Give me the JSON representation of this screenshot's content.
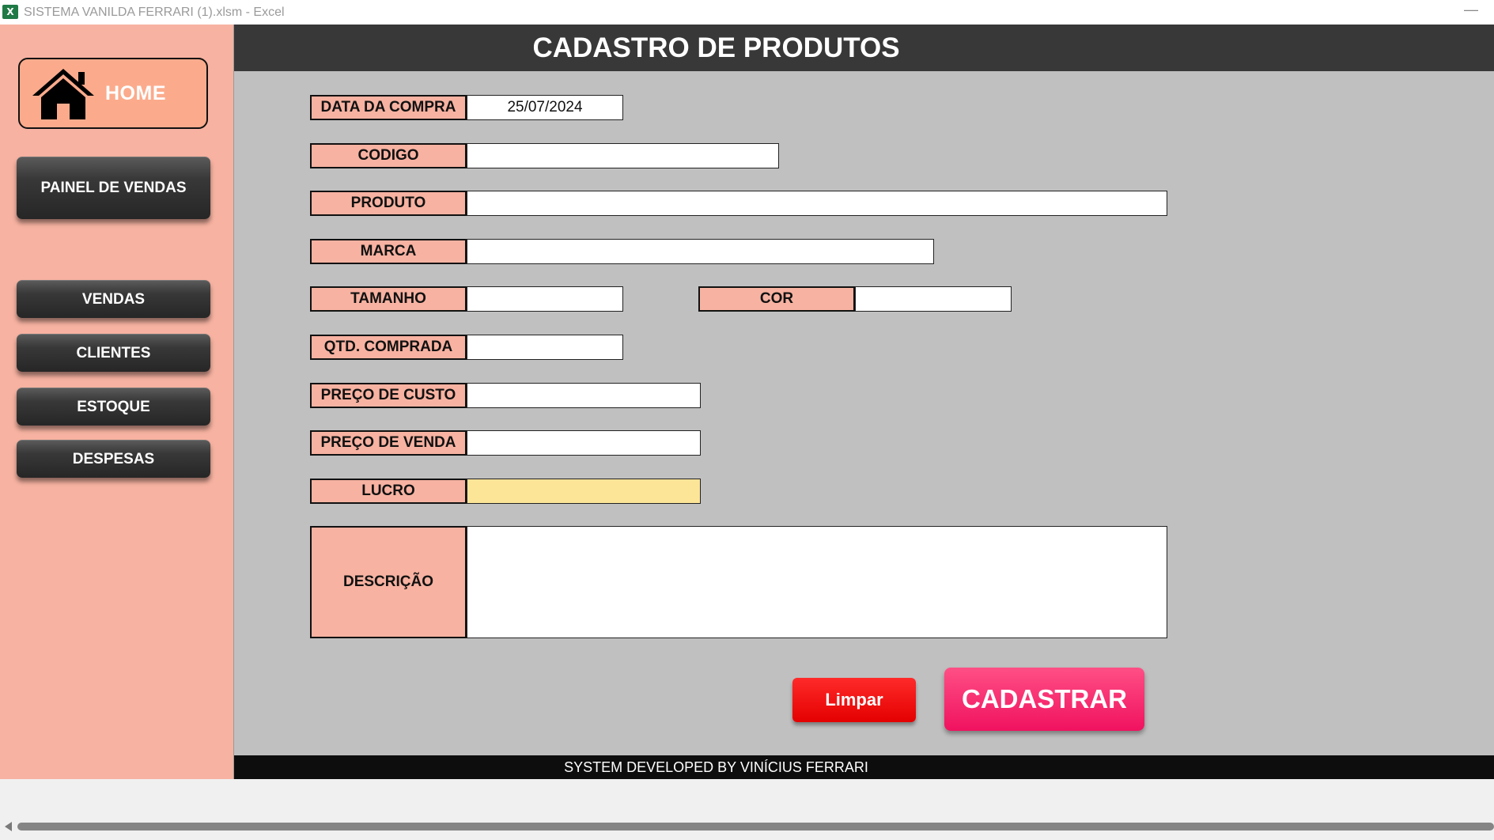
{
  "window": {
    "title": "SISTEMA VANILDA FERRARI (1).xlsm  -  Excel",
    "app_icon": "excel-icon",
    "minimize_symbol": "—"
  },
  "sidebar": {
    "home_label": "HOME",
    "home_icon": "home-icon",
    "painel_label": "PAINEL DE VENDAS",
    "vendas_label": "VENDAS",
    "clientes_label": "CLIENTES",
    "estoque_label": "ESTOQUE",
    "despesas_label": "DESPESAS"
  },
  "header": {
    "title": "CADASTRO DE PRODUTOS"
  },
  "form": {
    "data_compra": {
      "label": "DATA DA COMPRA",
      "value": "25/07/2024"
    },
    "codigo": {
      "label": "CODIGO",
      "value": ""
    },
    "produto": {
      "label": "PRODUTO",
      "value": ""
    },
    "marca": {
      "label": "MARCA",
      "value": ""
    },
    "tamanho": {
      "label": "TAMANHO",
      "value": ""
    },
    "cor": {
      "label": "COR",
      "value": ""
    },
    "qtd": {
      "label": "QTD. COMPRADA",
      "value": ""
    },
    "preco_custo": {
      "label": "PREÇO DE CUSTO",
      "value": ""
    },
    "preco_venda": {
      "label": "PREÇO DE VENDA",
      "value": ""
    },
    "lucro": {
      "label": "LUCRO",
      "value": ""
    },
    "descricao": {
      "label": "DESCRIÇÃO",
      "value": ""
    }
  },
  "actions": {
    "limpar_label": "Limpar",
    "cadastrar_label": "CADASTRAR"
  },
  "footer": {
    "text": "SYSTEM DEVELOPED BY VINÍCIUS FERRARI"
  },
  "colors": {
    "sidebar_bg": "#f7b2a1",
    "label_bg": "#f7b2a1",
    "main_bg": "#c0c0c0",
    "header_bg": "#383838",
    "lucro_bg": "#fde598",
    "limpar_bg": "#ff1a1a",
    "cadastrar_bg": "#ff2f72",
    "footer_bg": "#0d0d0d"
  }
}
